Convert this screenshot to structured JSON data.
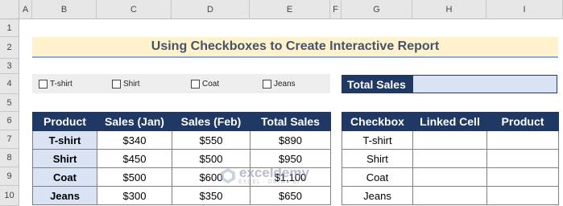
{
  "columns": [
    "A",
    "B",
    "C",
    "D",
    "E",
    "F",
    "G",
    "H",
    "I"
  ],
  "rows": [
    "1",
    "2",
    "3",
    "4",
    "5",
    "6",
    "7",
    "8",
    "9",
    "10"
  ],
  "title": "Using Checkboxes to Create Interactive Report",
  "checkboxes": [
    {
      "label": "T-shirt",
      "checked": false
    },
    {
      "label": "Shirt",
      "checked": false
    },
    {
      "label": "Coat",
      "checked": false
    },
    {
      "label": "Jeans",
      "checked": false
    }
  ],
  "total_sales": {
    "label": "Total Sales",
    "value": ""
  },
  "sales_table": {
    "headers": [
      "Product",
      "Sales (Jan)",
      "Sales (Feb)",
      "Total Sales"
    ],
    "rows": [
      [
        "T-shirt",
        "$340",
        "$550",
        "$890"
      ],
      [
        "Shirt",
        "$450",
        "$500",
        "$950"
      ],
      [
        "Coat",
        "$500",
        "$600",
        "$1,100"
      ],
      [
        "Jeans",
        "$300",
        "$350",
        "$650"
      ]
    ]
  },
  "link_table": {
    "headers": [
      "Checkbox",
      "Linked Cell",
      "Product"
    ],
    "rows": [
      [
        "T-shirt",
        "",
        ""
      ],
      [
        "Shirt",
        "",
        ""
      ],
      [
        "Coat",
        "",
        ""
      ],
      [
        "Jeans",
        "",
        ""
      ]
    ]
  },
  "watermark": {
    "name": "exceldemy",
    "tagline": "EXCEL · DATA · BI"
  }
}
